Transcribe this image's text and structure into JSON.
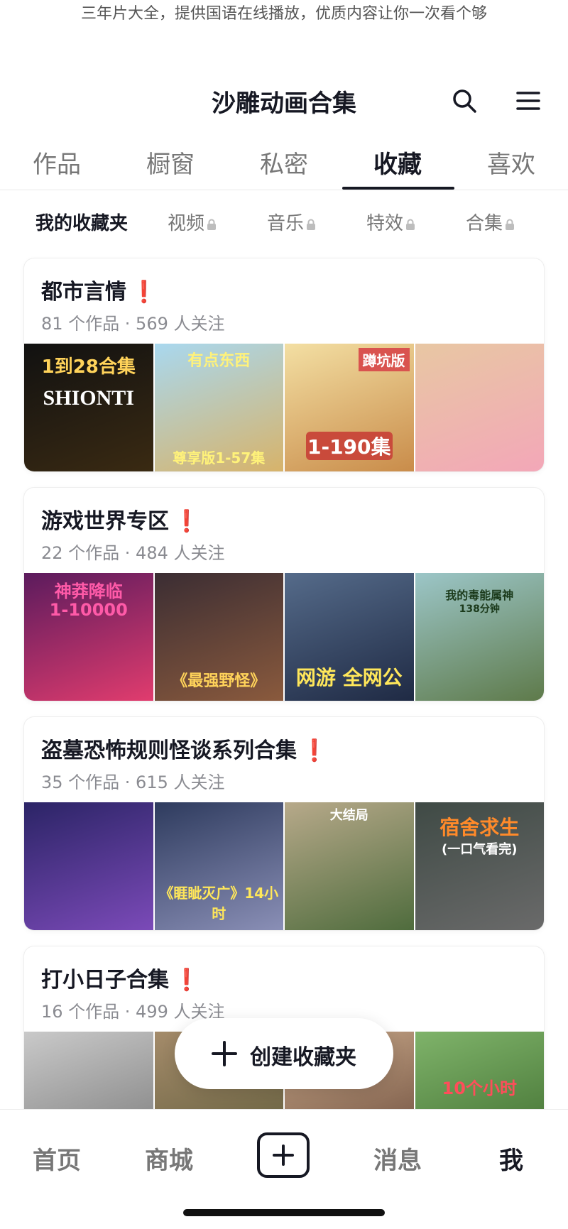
{
  "caption": "三年片大全，提供国语在线播放，优质内容让你一次看个够",
  "header": {
    "title": "沙雕动画合集",
    "icons": [
      "search-icon",
      "menu-icon"
    ]
  },
  "tabs": [
    {
      "label": "作品",
      "active": false
    },
    {
      "label": "橱窗",
      "active": false
    },
    {
      "label": "私密",
      "active": false
    },
    {
      "label": "收藏",
      "active": true
    },
    {
      "label": "喜欢",
      "active": false
    }
  ],
  "subtabs": [
    {
      "label": "我的收藏夹",
      "active": true,
      "locked": false
    },
    {
      "label": "视频",
      "active": false,
      "locked": true
    },
    {
      "label": "音乐",
      "active": false,
      "locked": true
    },
    {
      "label": "特效",
      "active": false,
      "locked": true
    },
    {
      "label": "合集",
      "active": false,
      "locked": true
    }
  ],
  "folders": [
    {
      "name": "都市言情",
      "mark": "❗",
      "meta": "81 个作品 · 569 人关注",
      "thumbs": [
        {
          "caption": "1到28合集",
          "subcaption": "SHIONTI",
          "colors": [
            "#111111",
            "#3a2a12"
          ]
        },
        {
          "caption": "有点东西",
          "subcaption": "尊享版1-57集",
          "colors": [
            "#a9d8ef",
            "#d7b36a"
          ]
        },
        {
          "caption": "蹲坑版",
          "subcaption": "1-190集",
          "colors": [
            "#f3dfa3",
            "#c98c4a"
          ]
        },
        {
          "caption": "",
          "subcaption": "",
          "colors": [
            "#e8c7a3",
            "#f3a7b8"
          ]
        }
      ]
    },
    {
      "name": "游戏世界专区",
      "mark": "❗",
      "meta": "22 个作品 · 484 人关注",
      "thumbs": [
        {
          "caption": "神莽降临",
          "subcaption": "1-10000",
          "colors": [
            "#5b1b5d",
            "#e13c6e"
          ]
        },
        {
          "caption": "",
          "subcaption": "《最强野怪》",
          "colors": [
            "#3b2d33",
            "#8a5a3d"
          ]
        },
        {
          "caption": "",
          "subcaption": "网游 全网公",
          "colors": [
            "#556b8a",
            "#1f2a44"
          ]
        },
        {
          "caption": "我的毒能属神",
          "subcaption": "138分钟",
          "colors": [
            "#9cc6c8",
            "#5e7a4a"
          ]
        }
      ]
    },
    {
      "name": "盗墓恐怖规则怪谈系列合集",
      "mark": "❗",
      "meta": "35 个作品 · 615 人关注",
      "thumbs": [
        {
          "caption": "",
          "subcaption": "",
          "colors": [
            "#2b2466",
            "#7b4ab8"
          ]
        },
        {
          "caption": "",
          "subcaption": "《睚眦灭广》14小时",
          "colors": [
            "#2e3b5e",
            "#8a8fb6"
          ]
        },
        {
          "caption": "大结局",
          "subcaption": "",
          "colors": [
            "#b7a98a",
            "#4f6c3d"
          ]
        },
        {
          "caption": "宿舍求生",
          "subcaption": "(一口气看完)",
          "colors": [
            "#3f4a45",
            "#6a6a6a"
          ]
        }
      ]
    },
    {
      "name": "打小日子合集",
      "mark": "❗",
      "meta": "16 个作品 · 499 人关注",
      "thumbs": [
        {
          "caption": "",
          "subcaption": "",
          "colors": [
            "#c9c9c9",
            "#7a7a7a"
          ]
        },
        {
          "caption": "",
          "subcaption": "",
          "colors": [
            "#a48b6a",
            "#5f5b3a"
          ]
        },
        {
          "caption": "",
          "subcaption": "",
          "colors": [
            "#c9a98a",
            "#6a4a3a"
          ]
        },
        {
          "caption": "",
          "subcaption": "10个小时",
          "colors": [
            "#7fb36a",
            "#3f6d2f"
          ]
        }
      ]
    }
  ],
  "create_button": {
    "label": "创建收藏夹",
    "icon": "plus-icon"
  },
  "bottom_nav": [
    {
      "label": "首页",
      "active": false
    },
    {
      "label": "商城",
      "active": false
    },
    {
      "label": "",
      "icon": "create-plus-icon"
    },
    {
      "label": "消息",
      "active": false
    },
    {
      "label": "我",
      "active": true
    }
  ],
  "colors": {
    "accent_mark": "#e5202e",
    "text": "#161823",
    "muted": "#8a8b91"
  }
}
